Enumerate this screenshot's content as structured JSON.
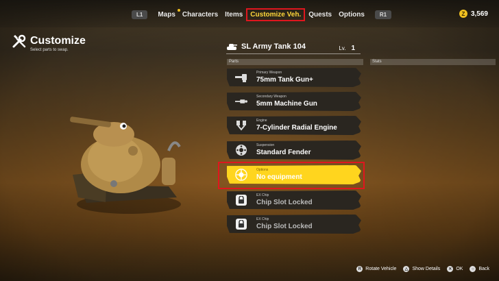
{
  "topnav": {
    "left_hint": "L1",
    "right_hint": "R1",
    "tabs": [
      {
        "label": "Maps"
      },
      {
        "label": "Characters"
      },
      {
        "label": "Items"
      },
      {
        "label": "Customize Veh."
      },
      {
        "label": "Quests"
      },
      {
        "label": "Options"
      }
    ],
    "currency_symbol": "Z",
    "currency": "3,569"
  },
  "header": {
    "title": "Customize",
    "subtitle": "Select parts to swap."
  },
  "vehicle": {
    "name": "SL Army Tank 104",
    "level_label": "Lv.",
    "level": "1"
  },
  "columns": {
    "parts": "Parts",
    "stats": "Stats"
  },
  "slots": [
    {
      "label": "Primary Weapon",
      "value": "75mm Tank Gun+"
    },
    {
      "label": "Secondary Weapon",
      "value": "5mm Machine Gun"
    },
    {
      "label": "Engine",
      "value": "7-Cylinder Radial Engine"
    },
    {
      "label": "Suspension",
      "value": "Standard Fender"
    },
    {
      "label": "Options",
      "value": "No equipment"
    },
    {
      "label": "EX Chip",
      "value": "Chip Slot Locked"
    },
    {
      "label": "EX Chip",
      "value": "Chip Slot Locked"
    }
  ],
  "footer": {
    "rotate": {
      "glyph": "R",
      "label": "Rotate Vehicle"
    },
    "details": {
      "glyph": "△",
      "label": "Show Details"
    },
    "ok": {
      "glyph": "✕",
      "label": "OK"
    },
    "back": {
      "glyph": "○",
      "label": "Back"
    }
  },
  "colors": {
    "accent": "#ffd51e",
    "highlight": "#e0161e"
  }
}
